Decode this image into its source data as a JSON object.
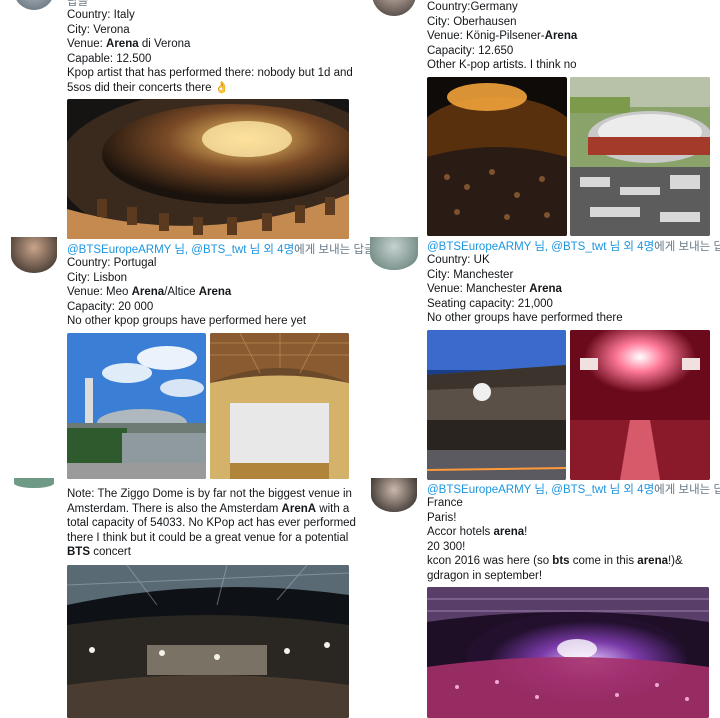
{
  "tweets": [
    {
      "id": "italy",
      "reply_prefix": "답글",
      "lines": [
        {
          "parts": [
            {
              "t": "Country: Italy",
              "b": false
            }
          ]
        },
        {
          "parts": [
            {
              "t": "City: Verona",
              "b": false
            }
          ]
        },
        {
          "parts": [
            {
              "t": "Venue: ",
              "b": false
            },
            {
              "t": "Arena",
              "b": true
            },
            {
              "t": " di Verona",
              "b": false
            }
          ]
        },
        {
          "parts": [
            {
              "t": "Capable: 12.500",
              "b": false
            }
          ]
        },
        {
          "parts": [
            {
              "t": "Kpop artist that has performed there: nobody but 1d and",
              "b": false
            }
          ]
        },
        {
          "parts": [
            {
              "t": "5sos did their concerts there 👌",
              "b": false
            }
          ]
        }
      ]
    },
    {
      "id": "germany",
      "lines": [
        {
          "parts": [
            {
              "t": "Country:Germany",
              "b": false
            }
          ]
        },
        {
          "parts": [
            {
              "t": "City: Oberhausen",
              "b": false
            }
          ]
        },
        {
          "parts": [
            {
              "t": "Venue: König-Pilsener-",
              "b": false
            },
            {
              "t": "Arena",
              "b": true
            }
          ]
        },
        {
          "parts": [
            {
              "t": "Capacity: 12.650",
              "b": false
            }
          ]
        },
        {
          "parts": [
            {
              "t": "Other K-pop artists. I think no",
              "b": false
            }
          ]
        }
      ]
    },
    {
      "id": "portugal",
      "reply": {
        "mentions": "@BTSEuropeARMY 님, @BTS_twt 님 외 4명",
        "suffix": "에게 보내는 답글"
      },
      "lines": [
        {
          "parts": [
            {
              "t": "Country: Portugal",
              "b": false
            }
          ]
        },
        {
          "parts": [
            {
              "t": "City: Lisbon",
              "b": false
            }
          ]
        },
        {
          "parts": [
            {
              "t": "Venue: Meo ",
              "b": false
            },
            {
              "t": "Arena",
              "b": true
            },
            {
              "t": "/Altice ",
              "b": false
            },
            {
              "t": "Arena",
              "b": true
            }
          ]
        },
        {
          "parts": [
            {
              "t": "Capacity: 20 000",
              "b": false
            }
          ]
        },
        {
          "parts": [
            {
              "t": "No other kpop groups have performed here yet",
              "b": false
            }
          ]
        }
      ]
    },
    {
      "id": "uk",
      "reply": {
        "mentions": "@BTSEuropeARMY 님, @BTS_twt 님 외 4명",
        "suffix": "에게 보내는 답글"
      },
      "lines": [
        {
          "parts": [
            {
              "t": "Country: UK",
              "b": false
            }
          ]
        },
        {
          "parts": [
            {
              "t": "City: Manchester",
              "b": false
            }
          ]
        },
        {
          "parts": [
            {
              "t": "Venue: Manchester ",
              "b": false
            },
            {
              "t": "Arena",
              "b": true
            }
          ]
        },
        {
          "parts": [
            {
              "t": "Seating capacity: 21,000",
              "b": false
            }
          ]
        },
        {
          "parts": [
            {
              "t": "No other groups have performed there",
              "b": false
            }
          ]
        }
      ]
    },
    {
      "id": "netherlands",
      "lines": [
        {
          "parts": [
            {
              "t": "Note: The Ziggo Dome is by far not the biggest venue in",
              "b": false
            }
          ]
        },
        {
          "parts": [
            {
              "t": "Amsterdam. There is also the Amsterdam ",
              "b": false
            },
            {
              "t": "ArenA",
              "b": true
            },
            {
              "t": " with a",
              "b": false
            }
          ]
        },
        {
          "parts": [
            {
              "t": "total capacity of 54033. No KPop act has ever performed",
              "b": false
            }
          ]
        },
        {
          "parts": [
            {
              "t": "there I think but it could be a great venue for a potential",
              "b": false
            }
          ]
        },
        {
          "parts": [
            {
              "t": "BTS",
              "b": true
            },
            {
              "t": " concert",
              "b": false
            }
          ]
        }
      ]
    },
    {
      "id": "france",
      "reply": {
        "mentions": "@BTSEuropeARMY 님, @BTS_twt 님 외 4명",
        "suffix": "에게 보내는 답글"
      },
      "lines": [
        {
          "parts": [
            {
              "t": "France",
              "b": false
            }
          ]
        },
        {
          "parts": [
            {
              "t": "Paris!",
              "b": false
            }
          ]
        },
        {
          "parts": [
            {
              "t": "Accor hotels ",
              "b": false
            },
            {
              "t": "arena",
              "b": true
            },
            {
              "t": "!",
              "b": false
            }
          ]
        },
        {
          "parts": [
            {
              "t": "20 300!",
              "b": false
            }
          ]
        },
        {
          "parts": [
            {
              "t": "kcon 2016 was here (so ",
              "b": false
            },
            {
              "t": "bts",
              "b": true
            },
            {
              "t": " come in this ",
              "b": false
            },
            {
              "t": "arena",
              "b": true
            },
            {
              "t": "!)&",
              "b": false
            }
          ]
        },
        {
          "parts": [
            {
              "t": "gdragon in september!",
              "b": false
            }
          ]
        }
      ]
    }
  ],
  "colors": {
    "link": "#1b95e0",
    "text": "#14171a",
    "muted": "#657786"
  }
}
